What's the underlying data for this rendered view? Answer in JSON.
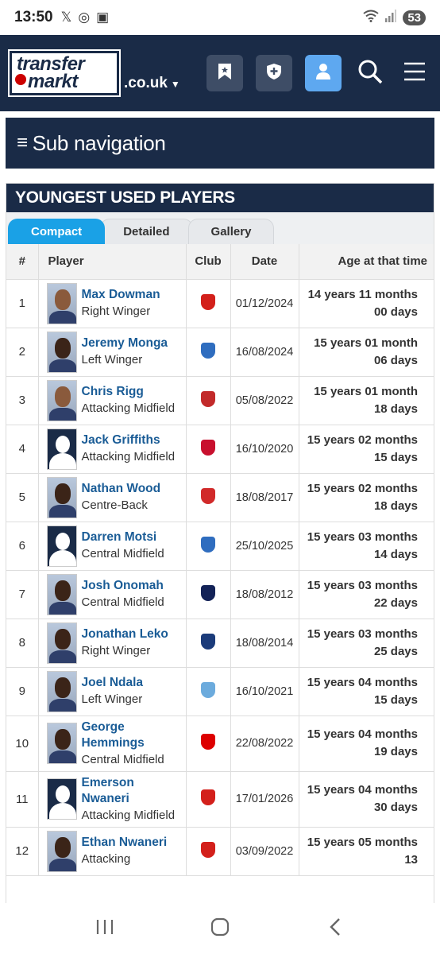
{
  "status": {
    "time": "13:50",
    "battery": "53"
  },
  "header": {
    "logo_line1": "transfer",
    "logo_line2": "markt",
    "domain": ".co.uk"
  },
  "subnav": {
    "label": "Sub navigation"
  },
  "box": {
    "title": "YOUNGEST USED PLAYERS"
  },
  "tabs": [
    {
      "label": "Compact",
      "active": true
    },
    {
      "label": "Detailed",
      "active": false
    },
    {
      "label": "Gallery",
      "active": false
    }
  ],
  "table": {
    "headers": {
      "num": "#",
      "player": "Player",
      "club": "Club",
      "date": "Date",
      "age": "Age at that time"
    },
    "rows": [
      {
        "num": "1",
        "name": "Max Dowman",
        "position": "Right Winger",
        "club_crest": "arsenal-crest-icon",
        "club_color": "#d3201b",
        "date": "01/12/2024",
        "age": "14 years 11 months 00 days",
        "avatar": "photo"
      },
      {
        "num": "2",
        "name": "Jeremy Monga",
        "position": "Left Winger",
        "club_crest": "leicester-crest-icon",
        "club_color": "#2f6dbf",
        "date": "16/08/2024",
        "age": "15 years 01 month 06 days",
        "avatar": "photo-dark"
      },
      {
        "num": "3",
        "name": "Chris Rigg",
        "position": "Attacking Midfield",
        "club_crest": "sunderland-crest-icon",
        "club_color": "#c22a2a",
        "date": "05/08/2022",
        "age": "15 years 01 month 18 days",
        "avatar": "photo"
      },
      {
        "num": "4",
        "name": "Jack Griffiths",
        "position": "Attacking Midfield",
        "club_crest": "stoke-crest-icon",
        "club_color": "#c8102e",
        "date": "16/10/2020",
        "age": "15 years 02 months 15 days",
        "avatar": "silhouette"
      },
      {
        "num": "5",
        "name": "Nathan Wood",
        "position": "Centre-Back",
        "club_crest": "middlesbrough-crest-icon",
        "club_color": "#d12a2a",
        "date": "18/08/2017",
        "age": "15 years 02 months 18 days",
        "avatar": "photo-dark"
      },
      {
        "num": "6",
        "name": "Darren Motsi",
        "position": "Central Midfield",
        "club_crest": "leicester-crest-icon",
        "club_color": "#2f6dbf",
        "date": "25/10/2025",
        "age": "15 years 03 months 14 days",
        "avatar": "silhouette"
      },
      {
        "num": "7",
        "name": "Josh Onomah",
        "position": "Central Midfield",
        "club_crest": "tottenham-crest-icon",
        "club_color": "#132257",
        "date": "18/08/2012",
        "age": "15 years 03 months 22 days",
        "avatar": "photo-dark"
      },
      {
        "num": "8",
        "name": "Jonathan Leko",
        "position": "Right Winger",
        "club_crest": "west-brom-crest-icon",
        "club_color": "#1b3b7a",
        "date": "18/08/2014",
        "age": "15 years 03 months 25 days",
        "avatar": "photo-dark"
      },
      {
        "num": "9",
        "name": "Joel Ndala",
        "position": "Left Winger",
        "club_crest": "man-city-crest-icon",
        "club_color": "#6cabdd",
        "date": "16/10/2021",
        "age": "15 years 04 months 15 days",
        "avatar": "photo-dark"
      },
      {
        "num": "10",
        "name": "George Hemmings",
        "position": "Central Midfield",
        "club_crest": "nottingham-forest-crest-icon",
        "club_color": "#dd0000",
        "date": "22/08/2022",
        "age": "15 years 04 months 19 days",
        "avatar": "photo-dark"
      },
      {
        "num": "11",
        "name": "Emerson Nwaneri",
        "position": "Attacking Midfield",
        "club_crest": "arsenal-crest-icon",
        "club_color": "#d3201b",
        "date": "17/01/2026",
        "age": "15 years 04 months 30 days",
        "avatar": "silhouette"
      },
      {
        "num": "12",
        "name": "Ethan Nwaneri",
        "position": "Attacking",
        "club_crest": "arsenal-crest-icon",
        "club_color": "#d3201b",
        "date": "03/09/2022",
        "age": "15 years 05 months 13",
        "avatar": "photo-dark"
      }
    ]
  },
  "icons": {
    "bookmark": "bookmark-icon",
    "shield": "shield-plus-icon",
    "user": "user-icon",
    "search": "search-icon",
    "menu": "menu-icon"
  },
  "colors": {
    "navy": "#1a2b47",
    "tab_active": "#1aa1e6",
    "link": "#1a5c96",
    "user_btn": "#5ea8f0"
  }
}
